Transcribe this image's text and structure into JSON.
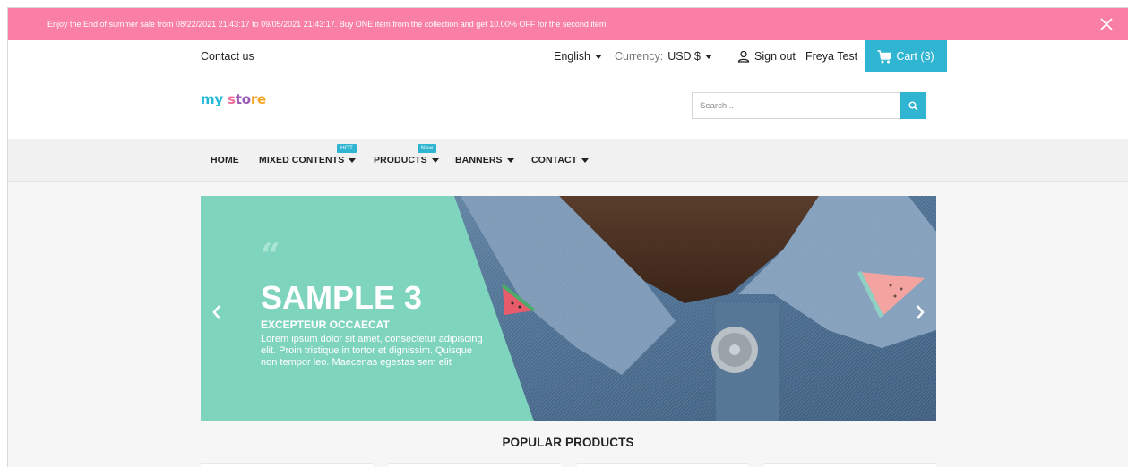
{
  "promo": {
    "text": "Enjoy the End of summer sale from 08/22/2021 21:43:17 to 09/05/2021 21:43:17. Buy ONE item from the collection and get 10.00% OFF for the second item!",
    "close_icon": "close-icon"
  },
  "topbar": {
    "contact": "Contact us",
    "language": "English",
    "currency_label": "Currency:",
    "currency_value": "USD $",
    "signout": "Sign out",
    "user": "Freya Test",
    "cart": "Cart (3)"
  },
  "header": {
    "logo": {
      "part1": "my",
      "part2": " s",
      "part3": "to",
      "part4": "re"
    },
    "search_placeholder": "Search..."
  },
  "menu": {
    "items": [
      {
        "label": "HOME"
      },
      {
        "label": "MIXED CONTENTS",
        "badge": "HOT"
      },
      {
        "label": "PRODUCTS",
        "badge": "New"
      },
      {
        "label": "BANNERS"
      },
      {
        "label": "CONTACT"
      }
    ]
  },
  "slider": {
    "quote": "“",
    "title": "SAMPLE 3",
    "subtitle": "EXCEPTEUR OCCAECAT",
    "description": "Lorem ipsum dolor sit amet, consectetur adipiscing elit. Proin tristique in tortor et dignissim. Quisque non tempor leo. Maecenas egestas sem elit"
  },
  "popular": {
    "heading": "POPULAR PRODUCTS"
  },
  "colors": {
    "promo": "#f97fa4",
    "accent": "#2fb5d2",
    "slide_teal": "#7fd4bd"
  }
}
